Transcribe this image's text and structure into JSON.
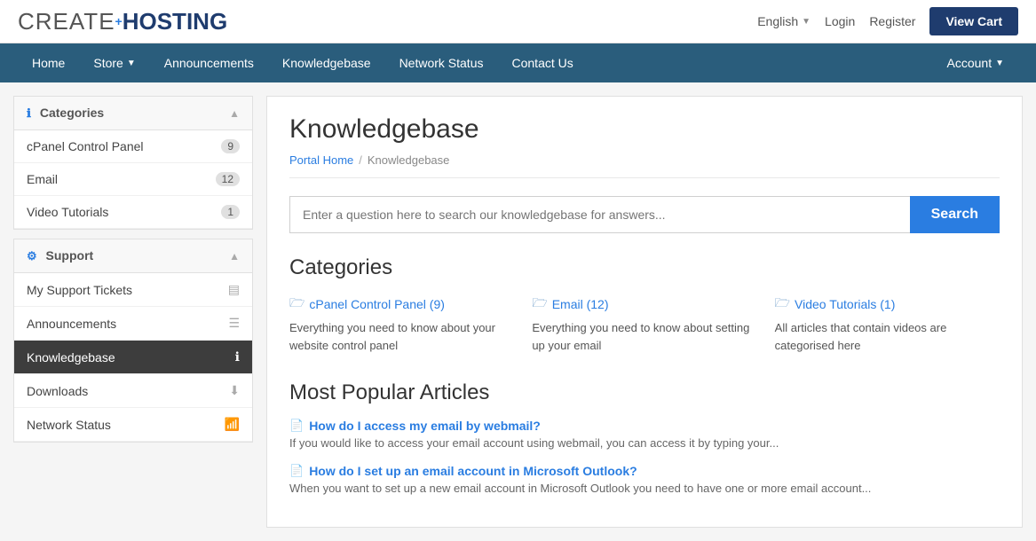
{
  "logo": {
    "create": "CREATE",
    "plus": "+",
    "hosting": "HOSTING"
  },
  "topbar": {
    "lang": "English",
    "login": "Login",
    "register": "Register",
    "viewcart": "View Cart"
  },
  "nav": {
    "items": [
      {
        "label": "Home",
        "has_dropdown": false
      },
      {
        "label": "Store",
        "has_dropdown": true
      },
      {
        "label": "Announcements",
        "has_dropdown": false
      },
      {
        "label": "Knowledgebase",
        "has_dropdown": false
      },
      {
        "label": "Network Status",
        "has_dropdown": false
      },
      {
        "label": "Contact Us",
        "has_dropdown": false
      }
    ],
    "account": "Account"
  },
  "sidebar": {
    "categories_header": "Categories",
    "categories": [
      {
        "label": "cPanel Control Panel",
        "count": "9"
      },
      {
        "label": "Email",
        "count": "12"
      },
      {
        "label": "Video Tutorials",
        "count": "1"
      }
    ],
    "support_header": "Support",
    "support_items": [
      {
        "label": "My Support Tickets",
        "active": false
      },
      {
        "label": "Announcements",
        "active": false
      },
      {
        "label": "Knowledgebase",
        "active": true
      },
      {
        "label": "Downloads",
        "active": false
      },
      {
        "label": "Network Status",
        "active": false
      }
    ]
  },
  "content": {
    "page_title": "Knowledgebase",
    "breadcrumb": {
      "home": "Portal Home",
      "sep": "/",
      "current": "Knowledgebase"
    },
    "search": {
      "placeholder": "Enter a question here to search our knowledgebase for answers...",
      "button": "Search"
    },
    "categories_title": "Categories",
    "categories": [
      {
        "link": "cPanel Control Panel (9)",
        "description": "Everything you need to know about your website control panel"
      },
      {
        "link": "Email (12)",
        "description": "Everything you need to know about setting up your email"
      },
      {
        "link": "Video Tutorials (1)",
        "description": "All articles that contain videos are categorised here"
      }
    ],
    "popular_title": "Most Popular Articles",
    "articles": [
      {
        "title": "How do I access my email by webmail?",
        "excerpt": "If you would like to access your email account using webmail, you can access it by typing your..."
      },
      {
        "title": "How do I set up an email account in Microsoft Outlook?",
        "excerpt": "When you want to set up a new email account in Microsoft Outlook you need to have one or more email account..."
      }
    ]
  }
}
